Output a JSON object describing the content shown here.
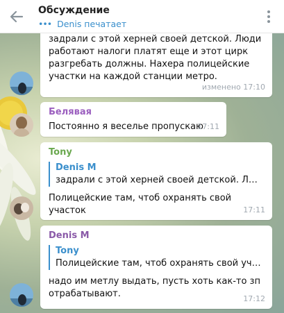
{
  "header": {
    "title": "Обсуждение",
    "typing_status": "Denis печатает",
    "typing_dots": "•••"
  },
  "messages": [
    {
      "lines": [
        "задрали с этой херней своей детской. Люди",
        "работают налоги платят еще и этот цирк",
        "разгребать должны. Нахера полицейские",
        "участки на каждой станции метро."
      ],
      "time": "изменено 17:10"
    },
    {
      "sender": "Белявая",
      "sender_color": "#9b5fbf",
      "text": "Постоянно я веселье пропускаю",
      "time": "17:11"
    },
    {
      "sender": "Tony",
      "sender_color": "#6aa84f",
      "reply_name": "Denis M",
      "reply_text": "задрали с этой херней своей детской. Люди ра...",
      "text": "Полицейские там, чтоб охранять свой участок",
      "time": "17:11"
    },
    {
      "sender": "Denis M",
      "sender_color": "#8a5aa8",
      "reply_name": "Tony",
      "reply_text": "Полицейские там, чтоб охранять свой участок",
      "lines": [
        "надо им метлу выдать, пусть хоть как-то зп",
        "отрабатывают."
      ],
      "time": "17:12"
    }
  ],
  "icons": {
    "back": "arrow-back-icon",
    "menu": "more-vert-icon"
  },
  "colors": {
    "accent": "#3a8fcc",
    "header_bg": "#ffffff"
  }
}
